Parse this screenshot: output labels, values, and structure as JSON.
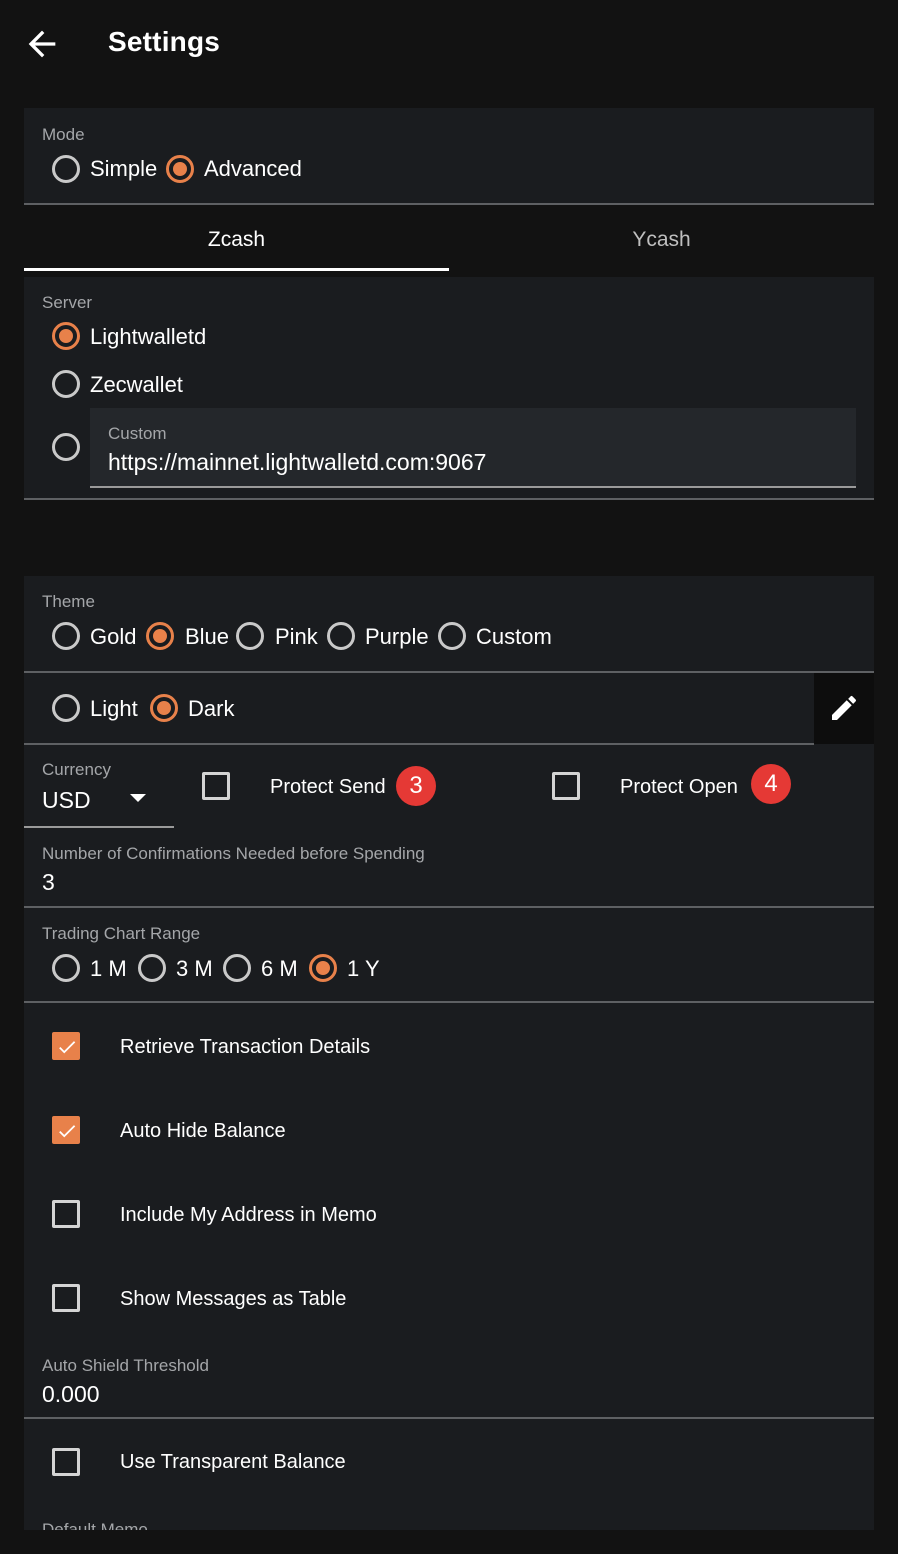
{
  "appbar": {
    "title": "Settings",
    "back_icon": "arrow-back-icon"
  },
  "mode": {
    "label": "Mode",
    "options": [
      {
        "label": "Simple",
        "selected": false
      },
      {
        "label": "Advanced",
        "selected": true
      }
    ]
  },
  "tabs": [
    {
      "label": "Zcash",
      "active": true
    },
    {
      "label": "Ycash",
      "active": false
    }
  ],
  "server": {
    "label": "Server",
    "options": [
      {
        "label": "Lightwalletd",
        "selected": true
      },
      {
        "label": "Zecwallet",
        "selected": false
      }
    ],
    "custom": {
      "label": "Custom",
      "value": "https://mainnet.lightwalletd.com:9067",
      "selected": false
    }
  },
  "theme": {
    "label": "Theme",
    "options": [
      {
        "label": "Gold",
        "selected": false
      },
      {
        "label": "Blue",
        "selected": true
      },
      {
        "label": "Pink",
        "selected": false
      },
      {
        "label": "Purple",
        "selected": false
      },
      {
        "label": "Custom",
        "selected": false
      }
    ],
    "brightness": [
      {
        "label": "Light",
        "selected": false
      },
      {
        "label": "Dark",
        "selected": true
      }
    ],
    "edit_icon": "pencil-icon"
  },
  "currency": {
    "label": "Currency",
    "value": "USD"
  },
  "protect_send": {
    "label": "Protect Send",
    "checked": false,
    "badge": "3"
  },
  "protect_open": {
    "label": "Protect Open",
    "checked": false,
    "badge": "4"
  },
  "confirmations": {
    "label": "Number of Confirmations Needed before Spending",
    "value": "3"
  },
  "chart_range": {
    "label": "Trading Chart Range",
    "options": [
      {
        "label": "1 M",
        "selected": false
      },
      {
        "label": "3 M",
        "selected": false
      },
      {
        "label": "6 M",
        "selected": false
      },
      {
        "label": "1 Y",
        "selected": true
      }
    ]
  },
  "checkboxes": [
    {
      "label": "Retrieve Transaction Details",
      "checked": true
    },
    {
      "label": "Auto Hide Balance",
      "checked": true
    },
    {
      "label": "Include My Address in Memo",
      "checked": false
    },
    {
      "label": "Show Messages as Table",
      "checked": false
    }
  ],
  "auto_shield": {
    "label": "Auto Shield Threshold",
    "value": "0.000"
  },
  "transparent_balance": {
    "label": "Use Transparent Balance",
    "checked": false
  },
  "default_memo": {
    "label": "Default Memo"
  },
  "colors": {
    "accent": "#e8814a",
    "badge": "#e53935",
    "card": "#1a1c1f",
    "background": "#121212"
  }
}
